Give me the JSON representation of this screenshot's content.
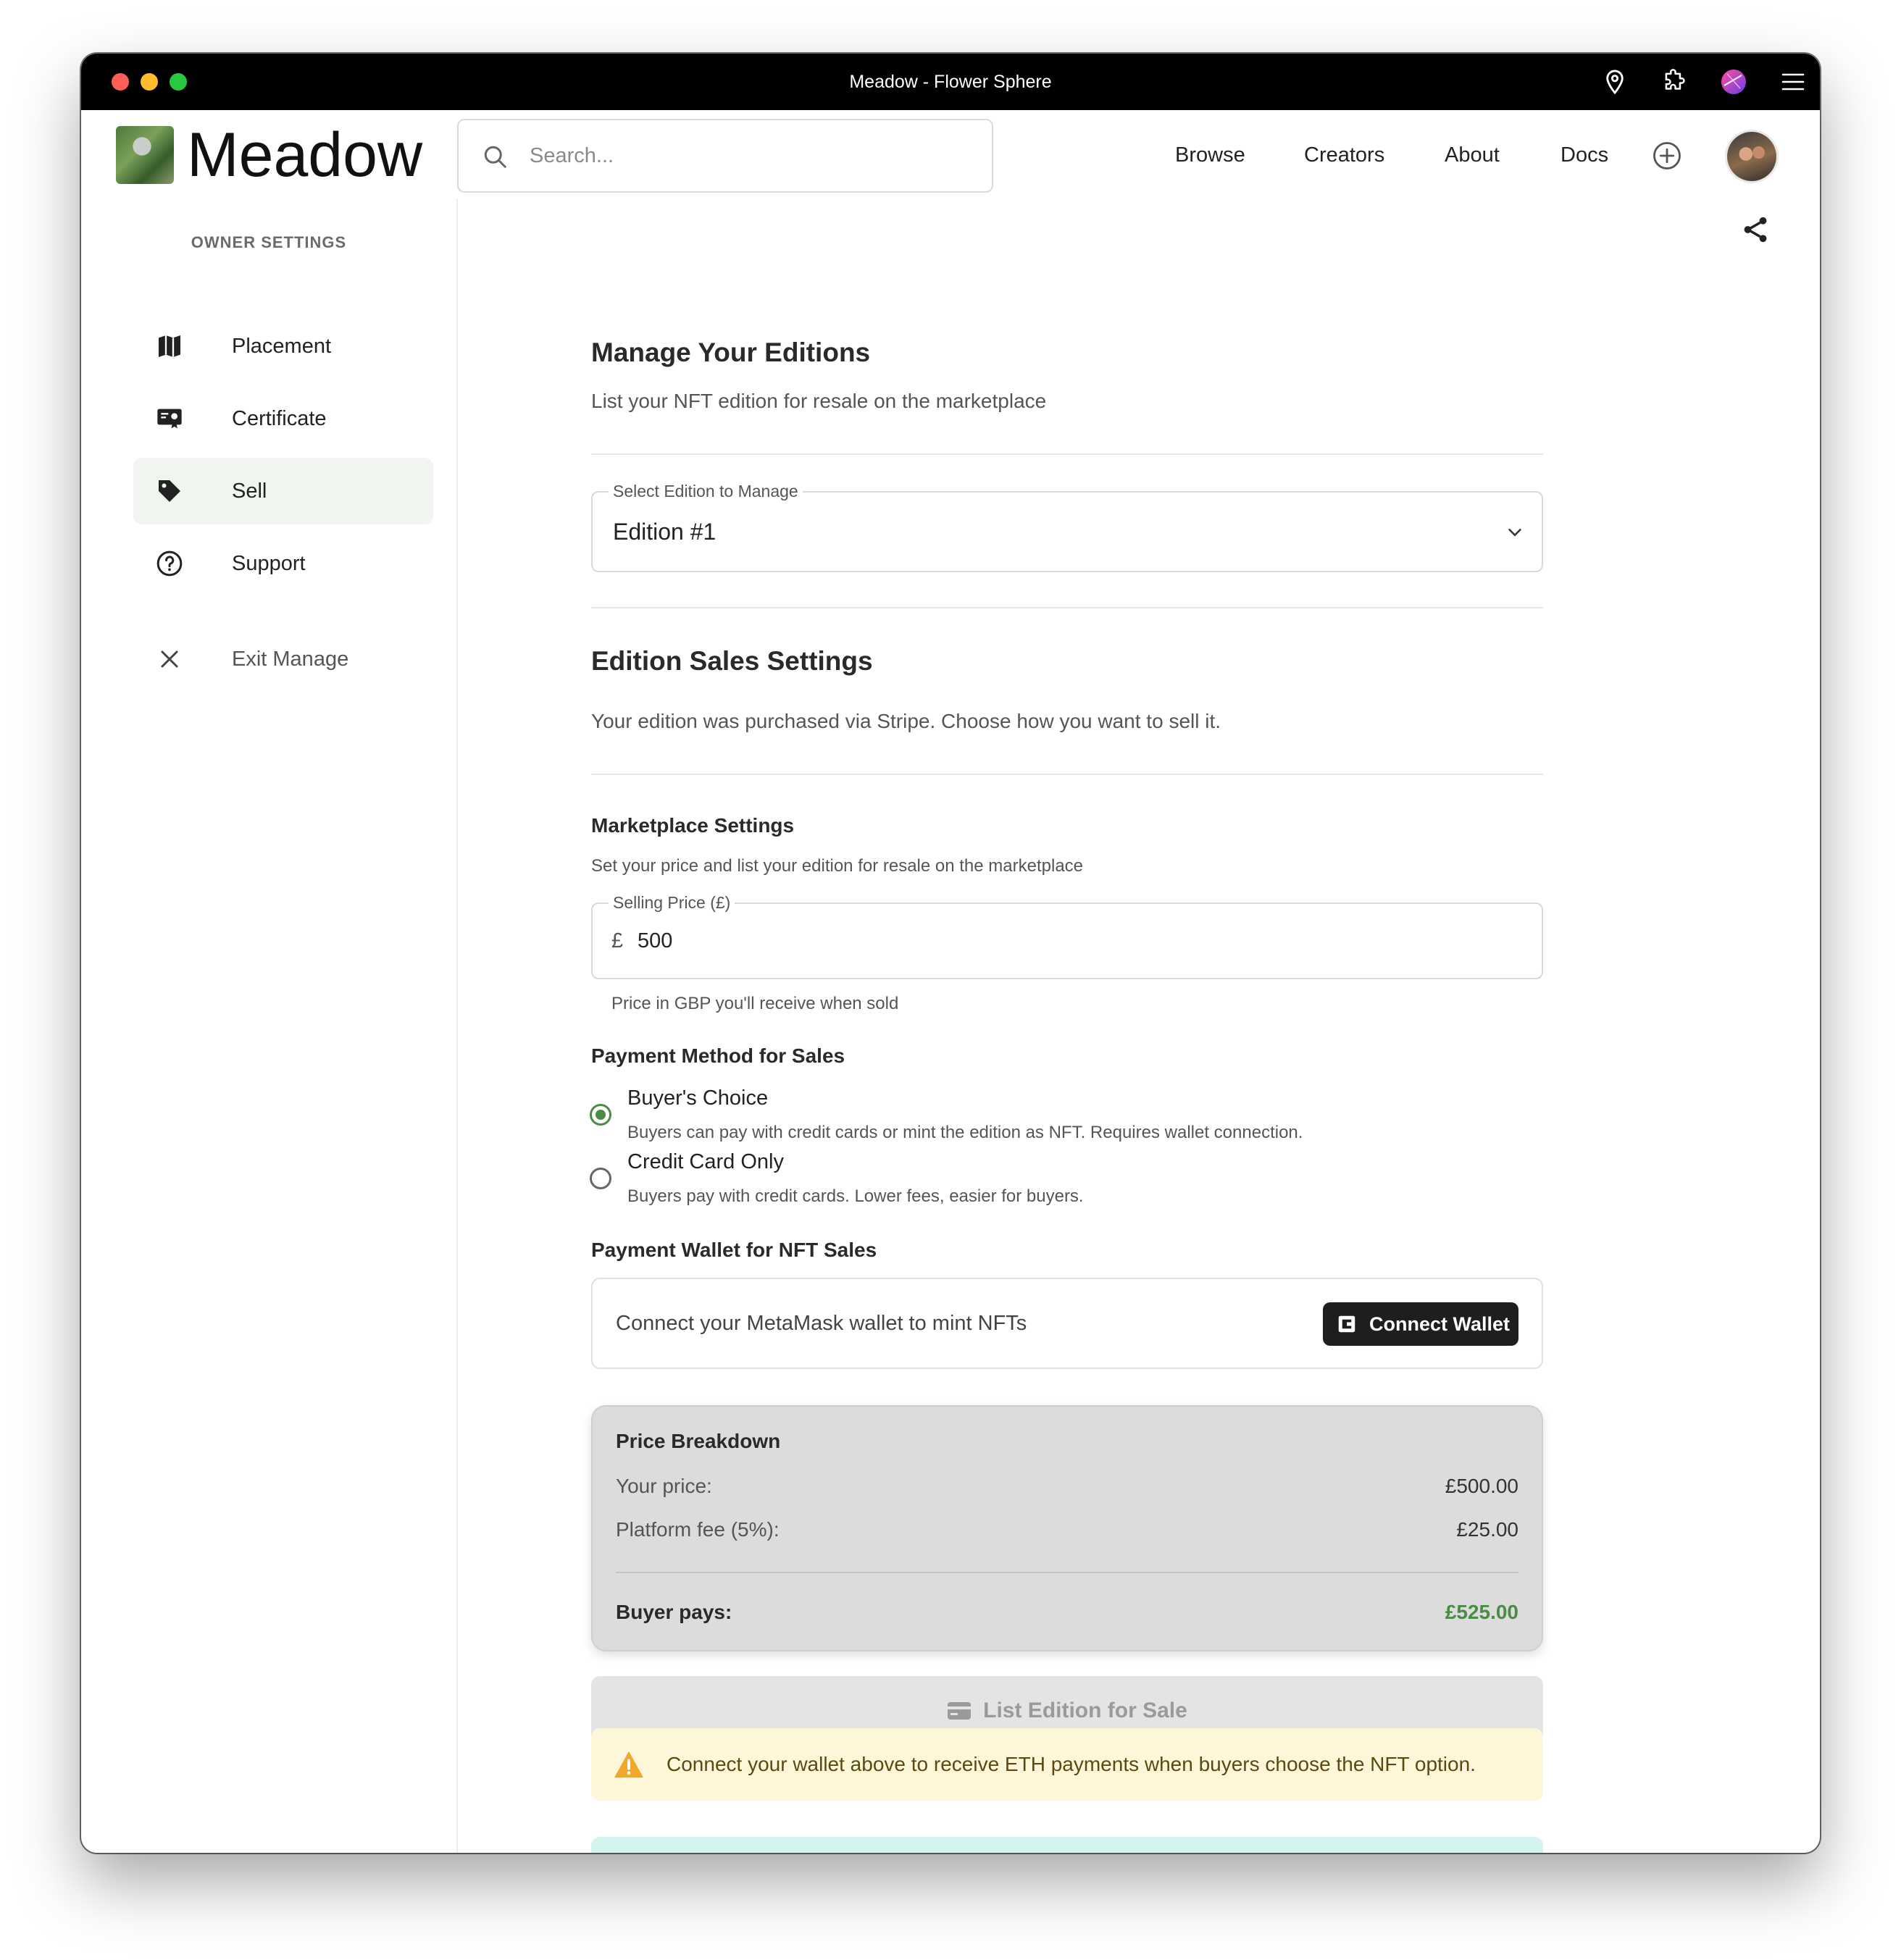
{
  "window": {
    "title": "Meadow - Flower Sphere"
  },
  "header": {
    "logo_text": "Meadow",
    "search_placeholder": "Search...",
    "nav": [
      "Browse",
      "Creators",
      "About",
      "Docs"
    ]
  },
  "sidebar": {
    "heading": "OWNER SETTINGS",
    "items": [
      {
        "label": "Placement",
        "icon": "map-icon"
      },
      {
        "label": "Certificate",
        "icon": "certificate-icon"
      },
      {
        "label": "Sell",
        "icon": "tag-icon",
        "active": true
      },
      {
        "label": "Support",
        "icon": "help-circle-icon"
      }
    ],
    "exit_label": "Exit Manage"
  },
  "main": {
    "title": "Manage Your Editions",
    "subtitle": "List your NFT edition for resale on the marketplace",
    "edition_select": {
      "label": "Select Edition to Manage",
      "value": "Edition #1"
    },
    "sales_settings": {
      "title": "Edition Sales Settings",
      "description": "Your edition was purchased via Stripe. Choose how you want to sell it."
    },
    "marketplace": {
      "title": "Marketplace Settings",
      "description": "Set your price and list your edition for resale on the marketplace",
      "price_label": "Selling Price (£)",
      "currency_symbol": "£",
      "price_value": "500",
      "price_helper": "Price in GBP you'll receive when sold"
    },
    "payment_method": {
      "title": "Payment Method for Sales",
      "options": [
        {
          "title": "Buyer's Choice",
          "desc": "Buyers can pay with credit cards or mint the edition as NFT. Requires wallet connection.",
          "selected": true
        },
        {
          "title": "Credit Card Only",
          "desc": "Buyers pay with credit cards. Lower fees, easier for buyers.",
          "selected": false
        }
      ]
    },
    "wallet": {
      "title": "Payment Wallet for NFT Sales",
      "message": "Connect your MetaMask wallet to mint NFTs",
      "button_label": "Connect Wallet"
    },
    "breakdown": {
      "title": "Price Breakdown",
      "your_price_label": "Your price:",
      "your_price_value": "£500.00",
      "fee_label": "Platform fee (5%):",
      "fee_value": "£25.00",
      "total_label": "Buyer pays:",
      "total_value": "£525.00"
    },
    "list_button_label": "List Edition for Sale",
    "warning_text": "Connect your wallet above to receive ETH payments when buyers choose the NFT option."
  },
  "colors": {
    "accent_green": "#4b8b45",
    "warning_bg": "#fdf6d8",
    "warning_icon": "#f0a82a"
  }
}
